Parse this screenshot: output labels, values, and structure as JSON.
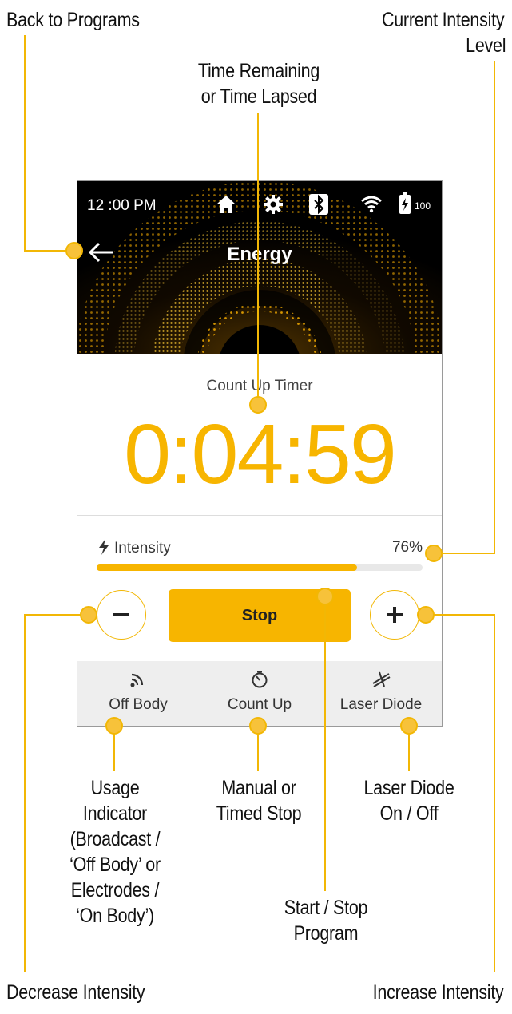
{
  "callouts": {
    "back": "Back to Programs",
    "current_intensity_1": "Current Intensity",
    "current_intensity_2": "Level",
    "time_1": "Time Remaining",
    "time_2": "or Time Lapsed",
    "usage_1": "Usage",
    "usage_2": "Indicator",
    "usage_3": "(Broadcast /",
    "usage_4": "‘Off Body’ or",
    "usage_5": "Electrodes /",
    "usage_6": "‘On Body’)",
    "manual_1": "Manual or",
    "manual_2": "Timed Stop",
    "laser_1": "Laser Diode",
    "laser_2": "On / Off",
    "startstop_1": "Start / Stop",
    "startstop_2": "Program",
    "decrease": "Decrease Intensity",
    "increase": "Increase Intensity"
  },
  "status_bar": {
    "time": "12 :00 PM",
    "battery": "100"
  },
  "header": {
    "title": "Energy"
  },
  "timer": {
    "label": "Count Up Timer",
    "value": "0:04:59"
  },
  "intensity": {
    "label": "Intensity",
    "value_text": "76%",
    "bar_fraction": 0.8
  },
  "controls": {
    "stop_label": "Stop"
  },
  "bottom_tabs": [
    {
      "label": "Off Body",
      "icon": "broadcast-icon"
    },
    {
      "label": "Count Up",
      "icon": "stopwatch-icon"
    },
    {
      "label": "Laser Diode",
      "icon": "laser-icon"
    }
  ],
  "colors": {
    "accent": "#f7b500",
    "callout_line": "#f2b705"
  }
}
